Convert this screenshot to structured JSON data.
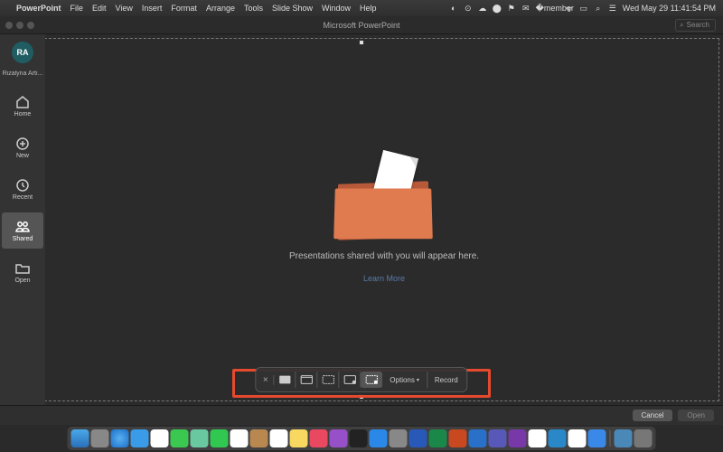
{
  "menubar": {
    "app_name": "PowerPoint",
    "items": [
      "File",
      "Edit",
      "View",
      "Insert",
      "Format",
      "Arrange",
      "Tools",
      "Slide Show",
      "Window",
      "Help"
    ],
    "datetime": "Wed May 29  11:41:54 PM"
  },
  "titlebar": {
    "title": "Microsoft PowerPoint",
    "search_placeholder": "Search"
  },
  "sidebar": {
    "user_initials": "RA",
    "user_name": "Rizalyna Arti...",
    "items": [
      {
        "id": "home",
        "label": "Home"
      },
      {
        "id": "new",
        "label": "New"
      },
      {
        "id": "recent",
        "label": "Recent"
      },
      {
        "id": "shared",
        "label": "Shared"
      },
      {
        "id": "open",
        "label": "Open"
      }
    ],
    "active": "shared"
  },
  "content": {
    "empty_message": "Presentations shared with you will appear here.",
    "learn_more_label": "Learn More"
  },
  "screenshot_toolbar": {
    "options_label": "Options",
    "record_label": "Record"
  },
  "footer": {
    "cancel_label": "Cancel",
    "open_label": "Open"
  },
  "colors": {
    "highlight": "#e64a2e",
    "folder_front": "#e07a4f",
    "folder_back": "#b85a3a",
    "avatar_bg": "#1f5d63",
    "link": "#5a7aa8"
  },
  "dock": {
    "apps": [
      "finder",
      "launchpad",
      "safari",
      "mail",
      "photos",
      "messages",
      "maps",
      "facetime",
      "calendar",
      "contacts",
      "reminders",
      "notes",
      "music",
      "podcasts",
      "tv",
      "appstore",
      "settings",
      "terminal",
      "word",
      "excel",
      "powerpoint",
      "outlook",
      "teams",
      "onenote",
      "chrome",
      "vscode",
      "slack",
      "zoom"
    ]
  }
}
